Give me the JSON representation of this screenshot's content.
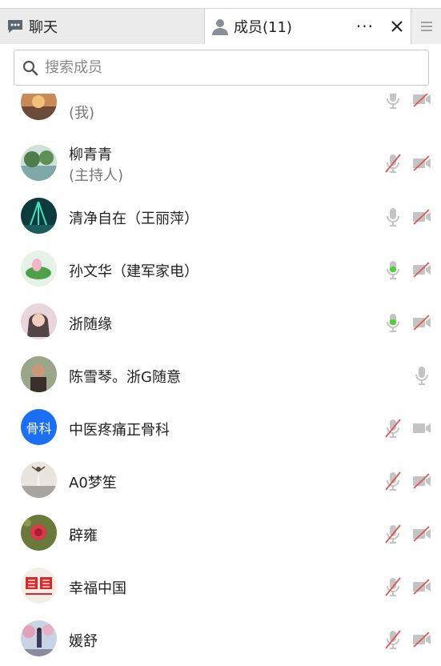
{
  "tabs": {
    "chat_label": "聊天",
    "members_label": "成员(11)",
    "more_label": "···",
    "close_label": "✕"
  },
  "search": {
    "placeholder": "搜索成员"
  },
  "members": [
    {
      "name": "",
      "sub": "(我)",
      "mic": "on-gray",
      "cam": "off"
    },
    {
      "name": "柳青青",
      "sub": "(主持人)",
      "mic": "off",
      "cam": "off"
    },
    {
      "name": "清净自在（王丽萍）",
      "sub": "",
      "mic": "on-gray",
      "cam": "off"
    },
    {
      "name": "孙文华（建军家电）",
      "sub": "",
      "mic": "active",
      "cam": "off"
    },
    {
      "name": "浙随缘",
      "sub": "",
      "mic": "active",
      "cam": "off"
    },
    {
      "name": "陈雪琴。浙G随意",
      "sub": "",
      "mic": "on-gray",
      "cam": "none"
    },
    {
      "name": "中医疼痛正骨科",
      "sub": "",
      "mic": "off",
      "cam": "on-gray",
      "avatar_text": "骨科"
    },
    {
      "name": "A0梦笙",
      "sub": "",
      "mic": "off",
      "cam": "off"
    },
    {
      "name": "辟雍",
      "sub": "",
      "mic": "off",
      "cam": "off"
    },
    {
      "name": "幸福中国",
      "sub": "",
      "mic": "off",
      "cam": "off"
    },
    {
      "name": "媛舒",
      "sub": "",
      "mic": "off",
      "cam": "off"
    }
  ],
  "colors": {
    "accent": "#1b6ff5",
    "mic_active": "#4cd137",
    "muted_red": "#e05555",
    "icon_gray": "#c4c4c4"
  }
}
